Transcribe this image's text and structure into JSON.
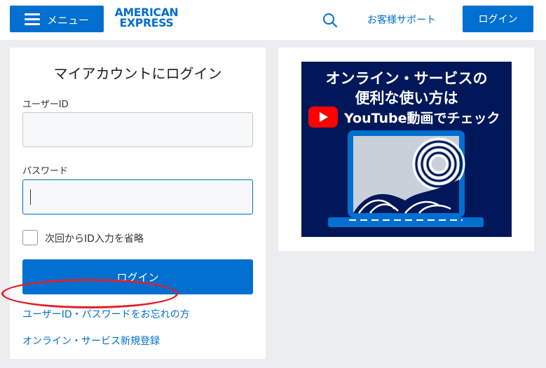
{
  "header": {
    "menu_label": "メニュー",
    "logo_line1": "AMERICAN",
    "logo_line2": "EXPRESS",
    "support_label": "お客様サポート",
    "login_label": "ログイン"
  },
  "login_form": {
    "title": "マイアカウントにログイン",
    "user_id_label": "ユーザーID",
    "user_id_value": "",
    "password_label": "パスワード",
    "password_value": "",
    "remember_label": "次回からID入力を省略",
    "remember_checked": false,
    "submit_label": "ログイン",
    "forgot_link": "ユーザーID・パスワードをお忘れの方",
    "register_link": "オンライン・サービス新規登録"
  },
  "promo": {
    "line1": "オンライン・サービスの",
    "line2": "便利な使い方は",
    "line3": "YouTube動画でチェック"
  },
  "colors": {
    "brand_blue": "#006fcf",
    "navy": "#00175a",
    "highlight_red": "#e41e26",
    "youtube_red": "#ff0000"
  }
}
